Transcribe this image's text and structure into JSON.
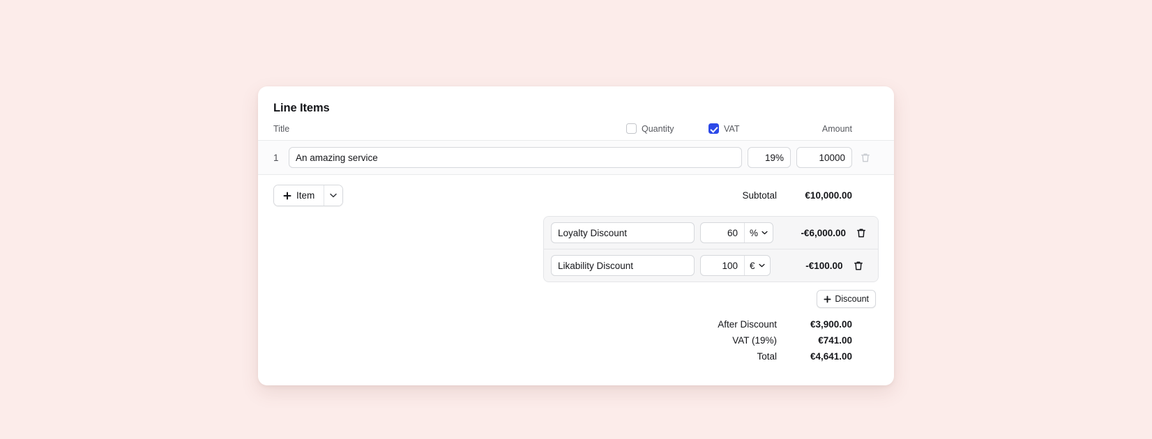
{
  "card": {
    "title": "Line Items"
  },
  "columns": {
    "title": "Title",
    "quantity": "Quantity",
    "vat": "VAT",
    "amount": "Amount",
    "quantity_checked": false,
    "vat_checked": true
  },
  "items": [
    {
      "number": "1",
      "title": "An amazing service",
      "title_placeholder": "Title",
      "vat": "19%",
      "amount": "10000"
    }
  ],
  "buttons": {
    "add_item": "Item",
    "add_item_icon": "plus-icon",
    "add_item_caret_icon": "chevron-down-icon",
    "add_discount": "Discount",
    "add_discount_icon": "plus-icon"
  },
  "subtotal": {
    "label": "Subtotal",
    "value": "€10,000.00"
  },
  "discounts": [
    {
      "name": "Loyalty Discount",
      "name_placeholder": "Discount name",
      "amount": "60",
      "unit": "%",
      "total": "-€6,000.00",
      "delete_icon": "trash-icon"
    },
    {
      "name": "Likability Discount",
      "name_placeholder": "Discount name",
      "amount": "100",
      "unit": "€",
      "total": "-€100.00",
      "delete_icon": "trash-icon"
    }
  ],
  "totals": [
    {
      "label": "After Discount",
      "value": "€3,900.00"
    },
    {
      "label": "VAT (19%)",
      "value": "€741.00"
    },
    {
      "label": "Total",
      "value": "€4,641.00"
    }
  ],
  "colors": {
    "page_background": "#fcecea",
    "card_background": "#ffffff",
    "checkbox_accent": "#2c49e8",
    "text_primary": "#15161a",
    "text_muted": "#57595f",
    "border": "#d6d8dc",
    "panel_background": "#f6f6f7"
  }
}
